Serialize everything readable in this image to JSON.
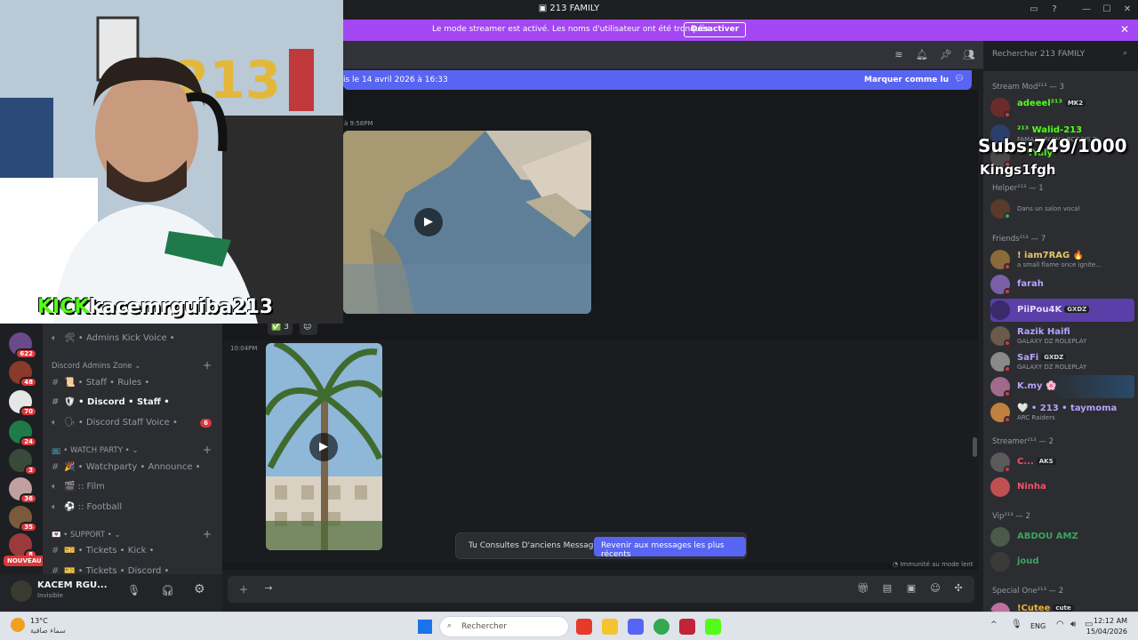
{
  "window": {
    "title": "213 FAMILY"
  },
  "banner": {
    "text": "Le mode streamer est activé. Les noms d'utilisateur ont été tronqués.",
    "button": "Désactiver"
  },
  "header": {
    "search_placeholder": "Rechercher 213 FAMILY"
  },
  "new_messages": {
    "text": "is le 14 avril 2026 à 16:33",
    "mark_read": "Marquer comme lu"
  },
  "chat": {
    "msg1_time": "à 9:58PM",
    "reaction_count": "3",
    "msg2_time": "10:04PM",
    "jump_text": "Tu Consultes D'anciens Messages",
    "jump_button": "Revenir aux messages les plus récents",
    "slowmode": "Immunité au mode lent"
  },
  "overlay": {
    "subs": "Subs:749/1000",
    "name": "Kings1fgh",
    "kick_brand": "KICK",
    "kick_user": "kacemrguiba213"
  },
  "servers": {
    "badges": [
      "622",
      "48",
      "70",
      "24",
      "3",
      "36",
      "35",
      "8"
    ],
    "new_label": "NOUVEAU"
  },
  "channels": {
    "items": [
      {
        "type": "voice",
        "label": "🛠 • Admins Kick Voice •"
      },
      {
        "type": "category",
        "label": "Discord Admins Zone"
      },
      {
        "type": "text",
        "label": "📜 • Staff • Rules •"
      },
      {
        "type": "text",
        "label": "🛡 • Discord • Staff •",
        "active": true
      },
      {
        "type": "voice",
        "label": "🗣 • Discord Staff Voice •",
        "unread": "6"
      },
      {
        "type": "category",
        "label": "📺 • WATCH PARTY •"
      },
      {
        "type": "text",
        "label": "🎉 • Watchparty • Announce •"
      },
      {
        "type": "voice",
        "label": "🎬 ꞉꞉ Film"
      },
      {
        "type": "voice",
        "label": "⚽ ꞉꞉ Football"
      },
      {
        "type": "category",
        "label": "💌 • SUPPORT •"
      },
      {
        "type": "text",
        "label": "🎫 • Tickets • Kick •"
      },
      {
        "type": "text",
        "label": "🎫 • Tickets • Discord •"
      }
    ]
  },
  "user": {
    "name": "KACEM RGU...",
    "status": "Invisible"
  },
  "members": {
    "roles": [
      {
        "label": "Stream Mod²¹³ — 3"
      },
      {
        "label": "Helper²¹³ — 1"
      },
      {
        "label": "Friends²¹³ — 7"
      },
      {
        "label": "Streamer²¹³ — 2"
      },
      {
        "label": "Vip²¹³ — 2"
      },
      {
        "label": "Special One²¹³ — 2"
      }
    ],
    "list": [
      {
        "name": "adeeel²¹³",
        "tag": "MK2",
        "color": "#53fc18",
        "avatar": "#6b2b2b"
      },
      {
        "name": "²¹³ Walid-213",
        "sub": "FAMASH,FASHA,BORGIS,T...",
        "color": "#53fc18",
        "avatar": "#2c3e6b"
      },
      {
        "name": "²¹³.Yaly",
        "sub": "",
        "color": "#53fc18",
        "avatar": "#4a4a4a"
      },
      {
        "name": "",
        "sub": "Dans un salon vocal",
        "color": "#f0b232",
        "avatar": "#5a3a2a"
      },
      {
        "name": "! iam7RAG 🔥",
        "sub": "a small flame once ignite...",
        "color": "#e9c46a",
        "avatar": "#8a6a3a"
      },
      {
        "name": "farah",
        "sub": "",
        "color": "#b5a3ff",
        "avatar": "#7b5fa8"
      },
      {
        "name": "PiiPou4K",
        "tag": "GXDZ",
        "color": "#b5a3ff",
        "avatar": "#5b3fa8"
      },
      {
        "name": "Razik Haifi",
        "sub": "GALAXY DZ ROLEPLAY",
        "color": "#b5a3ff",
        "avatar": "#6a5a4a"
      },
      {
        "name": "SaFi",
        "tag": "GXDZ",
        "sub": "GALAXY DZ ROLEPLAY",
        "color": "#b5a3ff",
        "avatar": "#8a8a8a"
      },
      {
        "name": "K.my 🌸",
        "sub": "",
        "color": "#b5a3ff",
        "avatar": "#a06a8a"
      },
      {
        "name": "🤍 • 213 • taymoma",
        "sub": "ARC Raiders",
        "color": "#b5a3ff",
        "avatar": "#c08040"
      },
      {
        "name": "C...",
        "tag": "AKS",
        "color": "#f0526a",
        "avatar": "#5a5a5a"
      },
      {
        "name": "Ninha",
        "sub": "",
        "color": "#f0526a",
        "avatar": "#c05050"
      },
      {
        "name": "ABDOU AMZ",
        "sub": "",
        "color": "#3ba55d",
        "avatar": "#4a5a4a"
      },
      {
        "name": "joud",
        "sub": "",
        "color": "#3ba55d",
        "avatar": "#3a3a3a"
      },
      {
        "name": "!Cutee",
        "tag": "cute",
        "color": "#f0b232",
        "avatar": "#c070a0"
      }
    ]
  },
  "taskbar": {
    "temp": "13°C",
    "weather": "سماء صافية",
    "search": "Rechercher",
    "lang": "ENG",
    "time": "12:12 AM",
    "date": "15/04/2026"
  },
  "colors": {
    "accent": "#5865f2",
    "streamer_banner": "#a347f2",
    "kick_green": "#53fc18"
  }
}
